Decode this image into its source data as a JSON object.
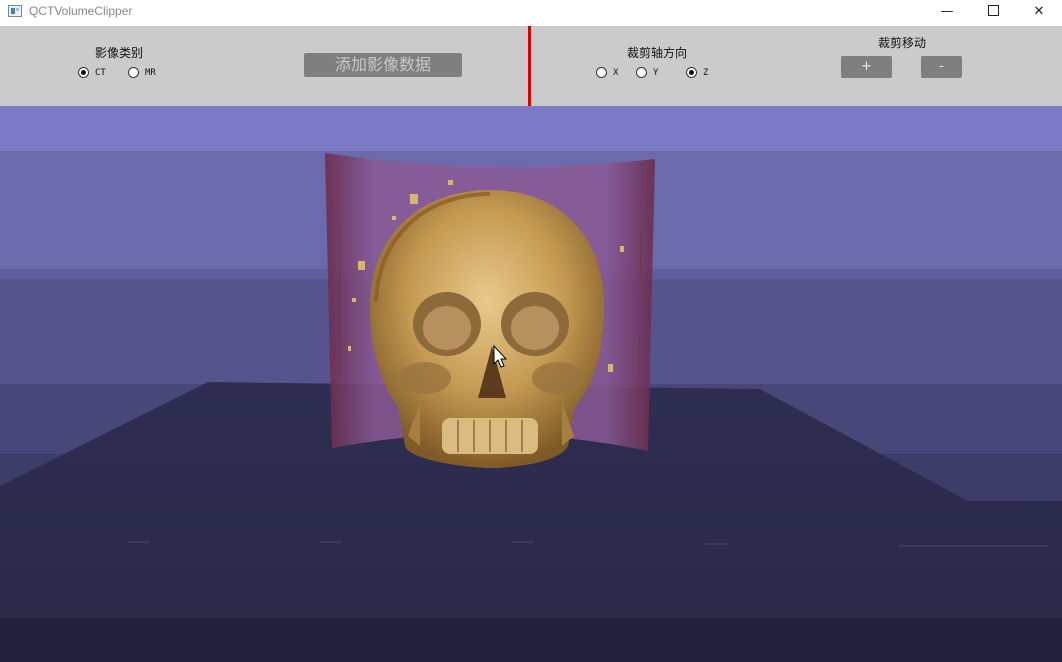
{
  "window": {
    "title": "QCTVolumeClipper",
    "minimize": "—",
    "close": "✕"
  },
  "panel": {
    "image_type": {
      "label": "影像类别",
      "options": [
        {
          "label": "CT",
          "checked": true
        },
        {
          "label": "MR",
          "checked": false
        }
      ]
    },
    "add_button": "添加影像数据",
    "clip_axis": {
      "label": "裁剪轴方向",
      "options": [
        {
          "label": "X",
          "checked": false
        },
        {
          "label": "Y",
          "checked": false
        },
        {
          "label": "Z",
          "checked": true
        }
      ]
    },
    "clip_move": {
      "label": "裁剪移动",
      "plus": "+",
      "minus": "-"
    }
  },
  "colors": {
    "divider": "#e00000",
    "panel_bg": "#cbcbcb",
    "button_bg": "#7f7f7f",
    "bone": "#c9a05a",
    "tissue": "#7a3a6a"
  },
  "icons": [
    "app-icon",
    "minimize-icon",
    "maximize-icon",
    "close-icon",
    "cursor-icon"
  ]
}
